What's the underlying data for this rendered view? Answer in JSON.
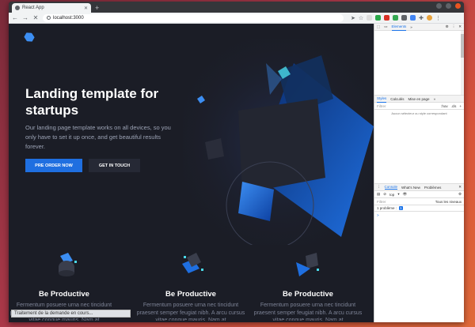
{
  "browser": {
    "tab_title": "React App",
    "new_tab": "+",
    "address": "localhost:3000"
  },
  "hero": {
    "title": "Landing template for startups",
    "text": "Our landing page template works on all devices, so you only have to set it up once, and get beautiful results forever.",
    "primary_button": "PRE ORDER NOW",
    "secondary_button": "GET IN TOUCH"
  },
  "features": [
    {
      "title": "Be Productive",
      "text": "Fermentum posuere urna nec tincidunt praesent semper feugiat nibh. A arcu cursus vitae congue mauris. Nam at"
    },
    {
      "title": "Be Productive",
      "text": "Fermentum posuere urna nec tincidunt praesent semper feugiat nibh. A arcu cursus vitae congue mauris. Nam at"
    },
    {
      "title": "Be Productive",
      "text": "Fermentum posuere urna nec tincidunt praesent semper feugiat nibh. A arcu cursus vitae congue mauris. Nam at"
    }
  ],
  "status_bar": "Traitement de la demande en cours...",
  "devtools": {
    "main_tab": "Elements",
    "styles_tabs": [
      "Styles",
      "Calculés",
      "Mise en page"
    ],
    "filter_placeholder": "Filtrer",
    "hov": ":hov",
    "cls": ".cls",
    "no_element": "Aucun sélecteur ou style correspondant",
    "drawer_tabs": [
      "Console",
      "What's New",
      "Problèmes"
    ],
    "context": "top",
    "console_filter": "Filtrer",
    "levels": "Tous les niveaux",
    "problems_text": "1 problème :",
    "problems_count": "1",
    "prompt": ">"
  },
  "colors": {
    "accent": "#1f6fe0",
    "page_bg": "#1b1d26",
    "desktop": "#b03a4a"
  }
}
